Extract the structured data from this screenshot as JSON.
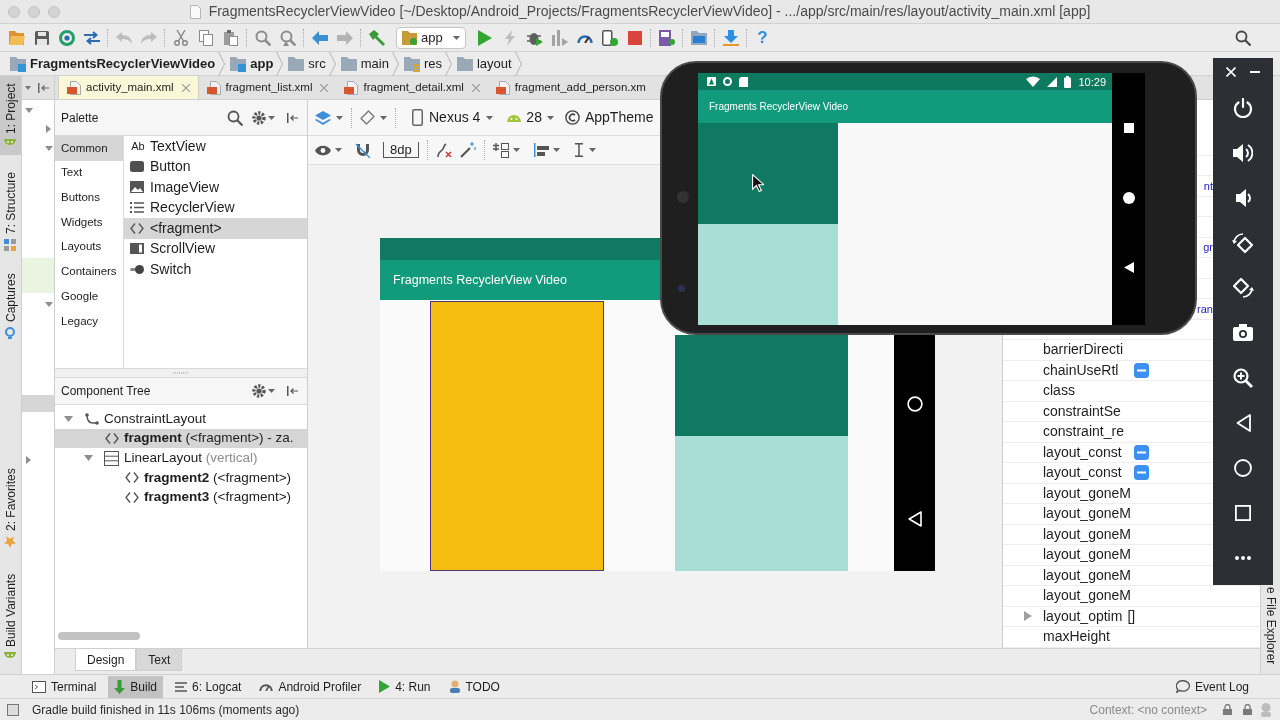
{
  "window": {
    "title": "FragmentsRecyclerViewVideo [~/Desktop/Android_Projects/FragmentsRecyclerViewVideo] - .../app/src/main/res/layout/activity_main.xml [app]"
  },
  "toolbar": {
    "run_configuration": "app",
    "help": "?"
  },
  "breadcrumbs": [
    {
      "label": "FragmentsRecyclerViewVideo",
      "kind": "project"
    },
    {
      "label": "app",
      "kind": "module"
    },
    {
      "label": "src",
      "kind": "folder"
    },
    {
      "label": "main",
      "kind": "folder"
    },
    {
      "label": "res",
      "kind": "resources"
    },
    {
      "label": "layout",
      "kind": "folder"
    }
  ],
  "left_tool_windows": [
    {
      "label": "1: Project",
      "kind": "android",
      "selected": true
    },
    {
      "label": "7: Structure",
      "kind": "structure",
      "selected": false
    },
    {
      "label": "Captures",
      "kind": "captures",
      "selected": false
    },
    {
      "label": "2: Favorites",
      "kind": "favorites",
      "selected": false
    },
    {
      "label": "Build Variants",
      "kind": "android",
      "selected": false
    }
  ],
  "editor_tabs": [
    {
      "label": "activity_main.xml",
      "selected": true
    },
    {
      "label": "fragment_list.xml",
      "selected": false
    },
    {
      "label": "fragment_detail.xml",
      "selected": false
    },
    {
      "label": "fragment_add_person.xm",
      "selected": false
    }
  ],
  "palette": {
    "title": "Palette",
    "categories": [
      {
        "label": "Common",
        "selected": true
      },
      {
        "label": "Text",
        "selected": false
      },
      {
        "label": "Buttons",
        "selected": false
      },
      {
        "label": "Widgets",
        "selected": false
      },
      {
        "label": "Layouts",
        "selected": false
      },
      {
        "label": "Containers",
        "selected": false
      },
      {
        "label": "Google",
        "selected": false
      },
      {
        "label": "Legacy",
        "selected": false
      }
    ],
    "items": [
      {
        "label": "TextView",
        "kind": "text",
        "glyph": "Ab",
        "selected": false
      },
      {
        "label": "Button",
        "kind": "button",
        "selected": false
      },
      {
        "label": "ImageView",
        "kind": "image",
        "selected": false
      },
      {
        "label": "RecyclerView",
        "kind": "list",
        "selected": false
      },
      {
        "label": "<fragment>",
        "kind": "fragment",
        "selected": true
      },
      {
        "label": "ScrollView",
        "kind": "scroll",
        "selected": false
      },
      {
        "label": "Switch",
        "kind": "switch",
        "selected": false
      }
    ]
  },
  "component_tree": {
    "title": "Component Tree",
    "nodes": [
      {
        "name": "ConstraintLayout",
        "kind": "constraint",
        "expanded": true,
        "selected": false,
        "children": [
          {
            "name": "fragment",
            "detail": "(<fragment>) - za.",
            "kind": "fragment",
            "selected": true
          },
          {
            "name": "LinearLayout",
            "detail": "(vertical)",
            "kind": "linear",
            "expanded": true,
            "selected": false,
            "children": [
              {
                "name": "fragment2",
                "detail": "(<fragment>)",
                "kind": "fragment",
                "selected": false
              },
              {
                "name": "fragment3",
                "detail": "(<fragment>)",
                "kind": "fragment",
                "selected": false
              }
            ]
          }
        ]
      }
    ]
  },
  "design_toolbar": {
    "device": "Nexus 4",
    "api_level": "28",
    "theme": "AppTheme",
    "default_margin": "8dp"
  },
  "layout_preview": {
    "app_title": "Fragments RecyclerView Video"
  },
  "attributes": {
    "cut_values": [
      {
        "text": "nt"
      },
      {
        "text": "gr"
      },
      {
        "text": "ran"
      }
    ],
    "rows": [
      {
        "name": "barrierDirecti",
        "remove_badge": false,
        "expandable": false
      },
      {
        "name": "chainUseRtl",
        "remove_badge": true,
        "expandable": false
      },
      {
        "name": "class",
        "remove_badge": false,
        "expandable": false
      },
      {
        "name": "constraintSe",
        "remove_badge": false,
        "expandable": false
      },
      {
        "name": "constraint_re",
        "remove_badge": false,
        "expandable": false
      },
      {
        "name": "layout_const",
        "remove_badge": true,
        "expandable": false
      },
      {
        "name": "layout_const",
        "remove_badge": true,
        "expandable": false
      },
      {
        "name": "layout_goneM",
        "remove_badge": false,
        "expandable": false
      },
      {
        "name": "layout_goneM",
        "remove_badge": false,
        "expandable": false
      },
      {
        "name": "layout_goneM",
        "remove_badge": false,
        "expandable": false
      },
      {
        "name": "layout_goneM",
        "remove_badge": false,
        "expandable": false
      },
      {
        "name": "layout_goneM",
        "remove_badge": false,
        "expandable": false
      },
      {
        "name": "layout_goneM",
        "remove_badge": false,
        "expandable": false
      },
      {
        "name": "layout_optim",
        "value": "[]",
        "remove_badge": false,
        "expandable": true
      },
      {
        "name": "maxHeight",
        "remove_badge": false,
        "expandable": false
      }
    ]
  },
  "right_tool_windows": [
    {
      "label": "e File Explorer"
    }
  ],
  "design_tabs": [
    {
      "label": "Design",
      "selected": true
    },
    {
      "label": "Text",
      "selected": false
    }
  ],
  "emulator": {
    "clock": "10:29",
    "app_title": "Fragments RecyclerView Video"
  },
  "bottom_tool_windows": [
    {
      "label": "Terminal",
      "kind": "terminal",
      "selected": false
    },
    {
      "label": "Build",
      "kind": "build",
      "selected": true
    },
    {
      "label": "6: Logcat",
      "kind": "logcat",
      "selected": false
    },
    {
      "label": "Android Profiler",
      "kind": "profiler",
      "selected": false
    },
    {
      "label": "4: Run",
      "kind": "run",
      "selected": false
    },
    {
      "label": "TODO",
      "kind": "todo",
      "selected": false
    },
    {
      "label": "Event Log",
      "kind": "event_log",
      "selected": false
    }
  ],
  "status_bar": {
    "message": "Gradle build finished in 11s 106ms (moments ago)",
    "context": "Context: <no context>"
  }
}
